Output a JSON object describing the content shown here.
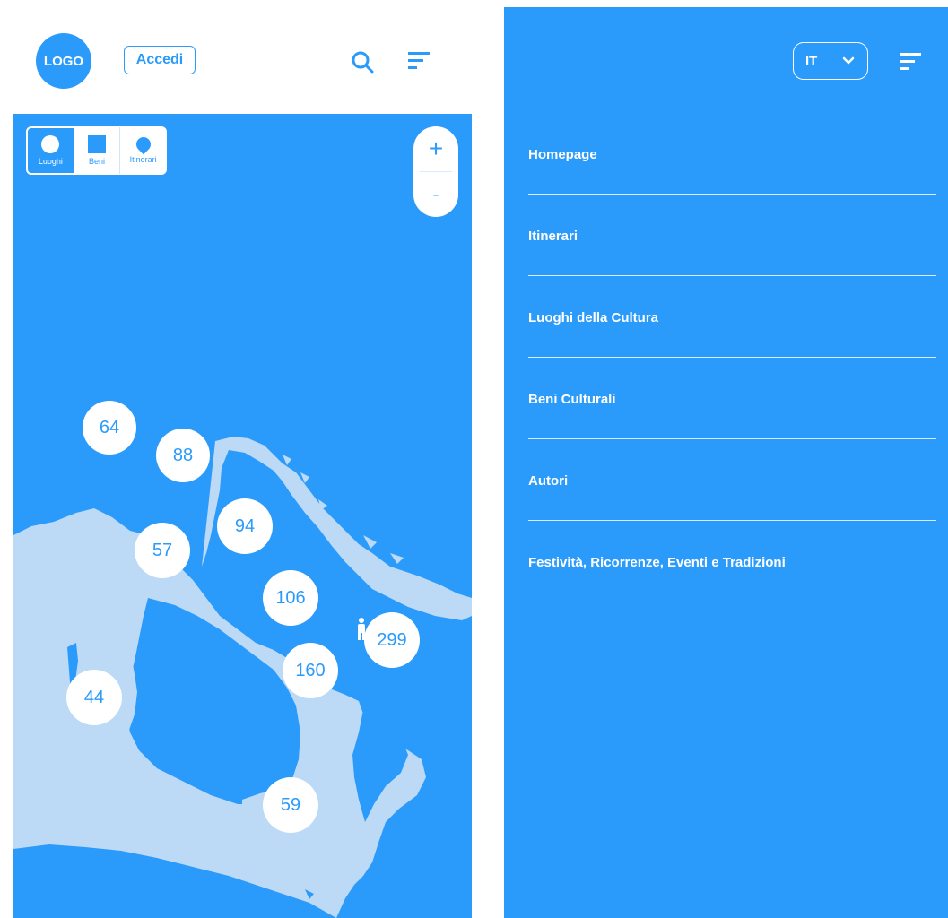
{
  "left": {
    "logo": "LOGO",
    "login_label": "Accedi",
    "icons": {
      "search": "search-icon",
      "menu": "menu-icon"
    },
    "filters": [
      {
        "label": "Luoghi",
        "icon": "circle-icon",
        "active": true
      },
      {
        "label": "Beni",
        "icon": "square-icon",
        "active": false
      },
      {
        "label": "Itinerari",
        "icon": "pin-icon",
        "active": false
      }
    ],
    "zoom": {
      "in": "+",
      "out": "-"
    },
    "clusters": [
      "64",
      "88",
      "94",
      "57",
      "106",
      "299",
      "160",
      "44",
      "59"
    ]
  },
  "right": {
    "language": "IT",
    "nav": [
      "Homepage",
      "Itinerari",
      "Luoghi della Cultura",
      "Beni Culturali",
      "Autori",
      "Festività, Ricorrenze, Eventi e Tradizioni"
    ]
  },
  "colors": {
    "primary": "#2b9bfb",
    "land": "#bcdaf5",
    "white": "#ffffff"
  }
}
